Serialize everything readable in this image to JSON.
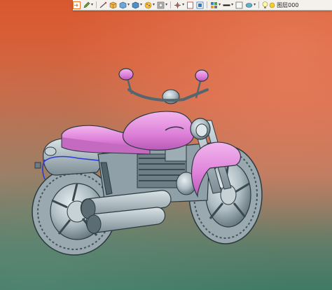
{
  "toolbar": {
    "items": [
      {
        "name": "open-file-icon"
      },
      {
        "name": "pen-tool-icon"
      },
      {
        "name": "smart-dimension-icon"
      },
      {
        "name": "box-view-icon"
      },
      {
        "name": "display-style-icon"
      },
      {
        "name": "hide-show-icon"
      },
      {
        "name": "appearance-icon"
      },
      {
        "name": "scene-icon"
      },
      {
        "name": "view-settings-icon"
      },
      {
        "name": "section-view-icon"
      },
      {
        "name": "view-orientation-icon"
      },
      {
        "name": "line-style-icon"
      },
      {
        "name": "color-swatch-icon"
      },
      {
        "name": "material-icon"
      }
    ],
    "layer_label": "图层000",
    "colors": {
      "bar": "#f4f1ec",
      "accent_orange": "#e8782b",
      "accent_blue": "#2a78c8"
    }
  },
  "viewport": {
    "model": "motorcycle-3d-model",
    "colors": {
      "body": "#b9c6cc",
      "highlight": "#e489df",
      "edge": "#2c3a40",
      "selection": "#2b3bd6"
    }
  }
}
